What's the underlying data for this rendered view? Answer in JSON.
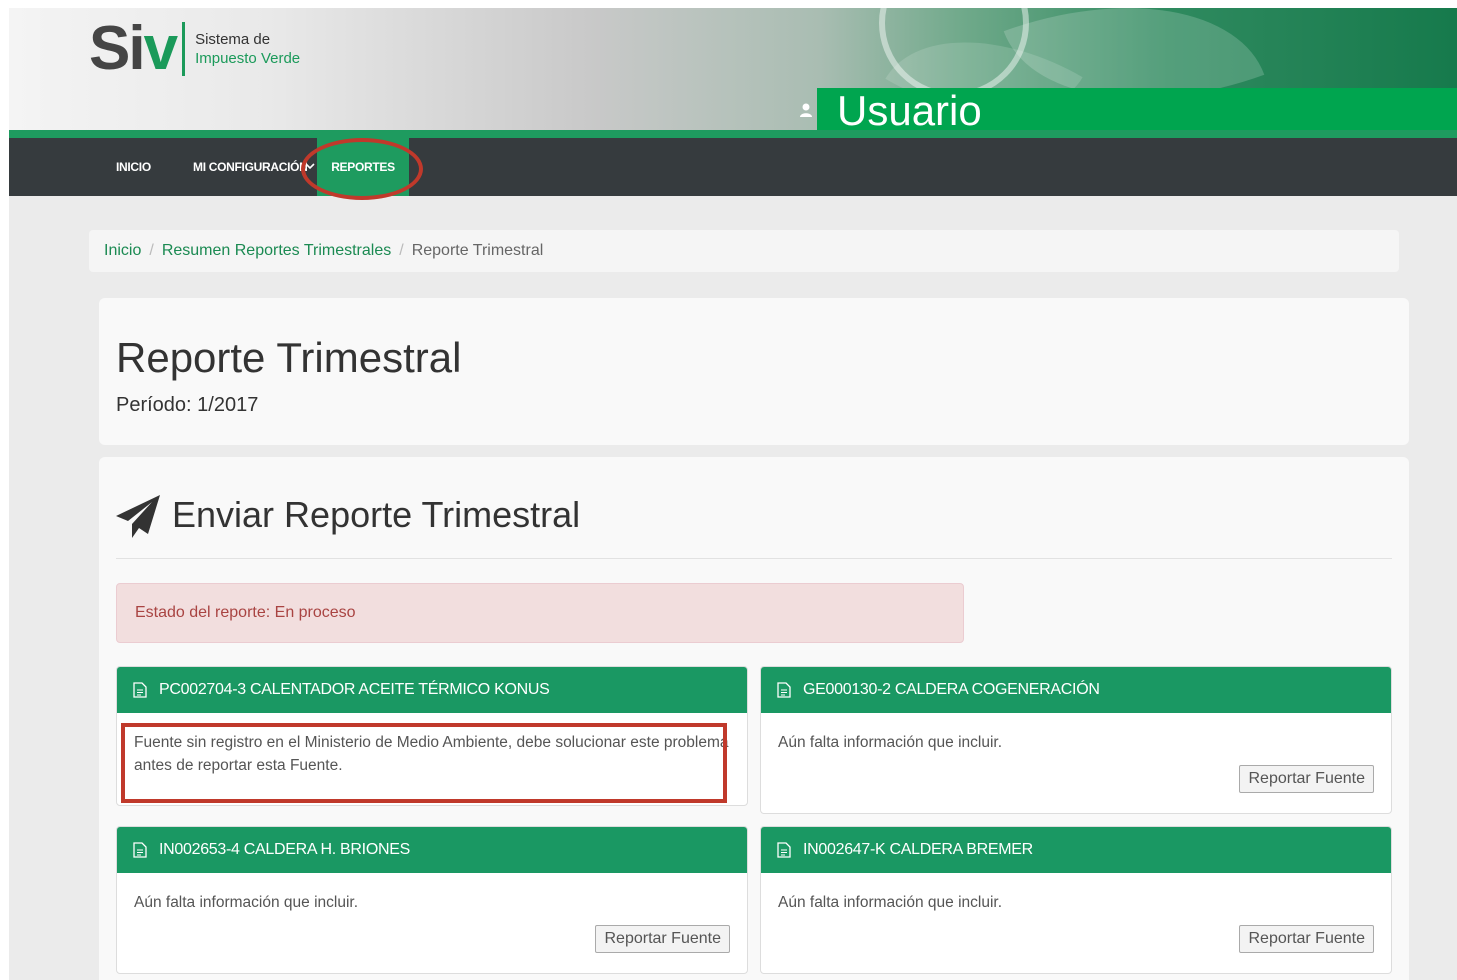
{
  "header": {
    "logo_main_s": "Si",
    "logo_main_v": "v",
    "logo_sub_line1": "Sistema de",
    "logo_sub_line2": "Impuesto Verde",
    "user_label": "Usuario",
    "user_icon": "user-icon"
  },
  "nav": {
    "items": [
      {
        "label": "INICIO"
      },
      {
        "label": "MI CONFIGURACIÓN"
      },
      {
        "label": "REPORTES"
      }
    ],
    "chevron_icon": "chevron-down-icon",
    "active_color": "#1e9b5f"
  },
  "breadcrumb": {
    "items": [
      "Inicio",
      "Resumen Reportes Trimestrales",
      "Reporte Trimestral"
    ]
  },
  "page": {
    "title": "Reporte Trimestral",
    "period": "Período: 1/2017"
  },
  "send_section": {
    "title": "Enviar Reporte Trimestral",
    "icon": "paper-plane-icon"
  },
  "alert": {
    "text": "Estado del reporte: En proceso"
  },
  "cards": [
    {
      "title": "PC002704-3 CALENTADOR ACEITE TÉRMICO KONUS",
      "message": "Fuente sin registro en el Ministerio de Medio Ambiente, debe solucionar este problema antes de reportar esta Fuente.",
      "has_button": false
    },
    {
      "title": "GE000130-2 CALDERA COGENERACIÓN",
      "message": "Aún falta información que incluir.",
      "button": "Reportar Fuente"
    },
    {
      "title": "IN002653-4 CALDERA H. BRIONES",
      "message": "Aún falta información que incluir.",
      "button": "Reportar Fuente"
    },
    {
      "title": "IN002647-K CALDERA BREMER",
      "message": "Aún falta información que incluir.",
      "button": "Reportar Fuente"
    }
  ],
  "colors": {
    "brand_green": "#1a9863",
    "highlight_red": "#c0392b",
    "alert_bg": "#f2dede",
    "alert_text": "#a94442"
  }
}
